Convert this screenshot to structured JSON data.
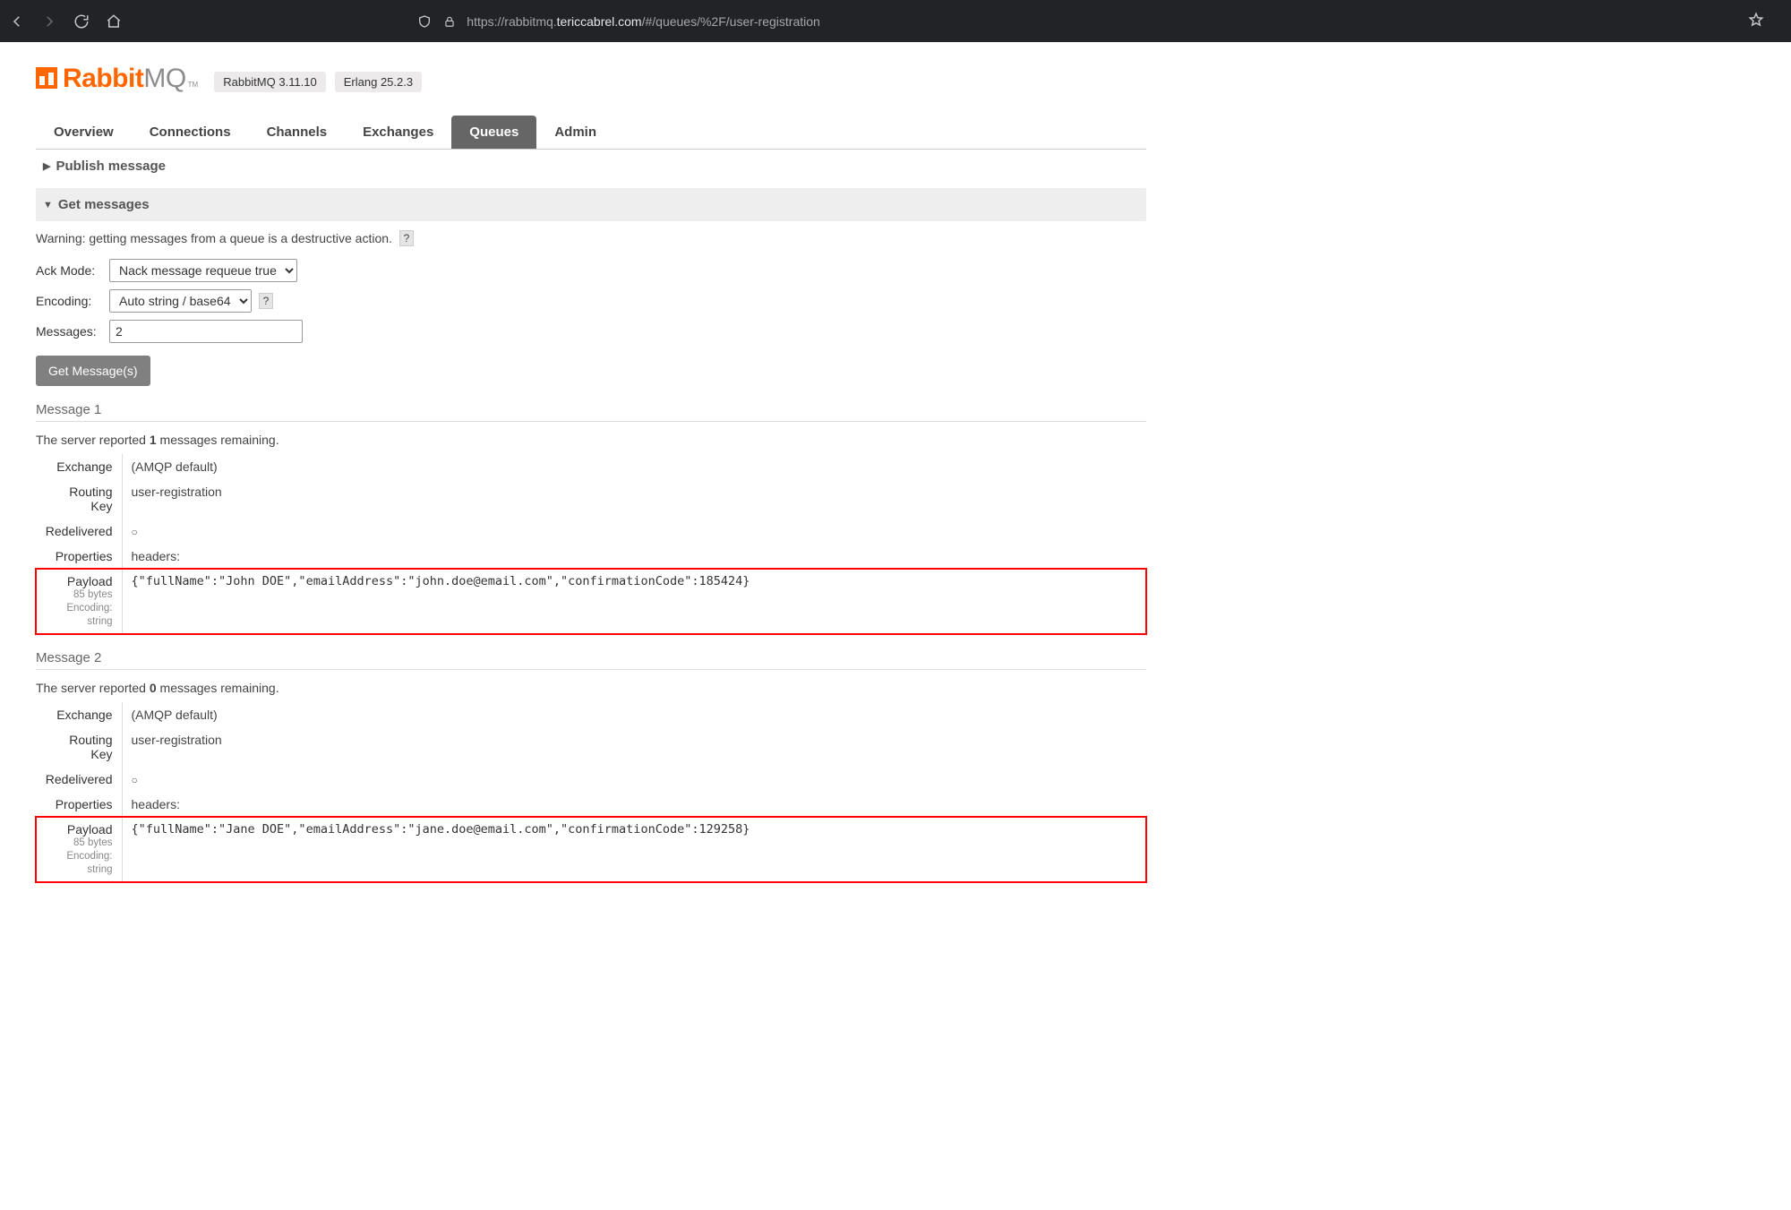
{
  "browser": {
    "url_host": "tericcabrel.com",
    "url_prefix": "https://rabbitmq.",
    "url_path": "/#/queues/%2F/user-registration"
  },
  "logo": {
    "left": "Rabbit",
    "right": "MQ",
    "tm": "TM"
  },
  "versions": {
    "rabbit": "RabbitMQ 3.11.10",
    "erlang": "Erlang 25.2.3"
  },
  "nav": {
    "overview": "Overview",
    "connections": "Connections",
    "channels": "Channels",
    "exchanges": "Exchanges",
    "queues": "Queues",
    "admin": "Admin"
  },
  "sections": {
    "publish": "Publish message",
    "get": "Get messages"
  },
  "warning": "Warning: getting messages from a queue is a destructive action.",
  "help_label": "?",
  "form": {
    "ack_label": "Ack Mode:",
    "ack_value": "Nack message requeue true",
    "enc_label": "Encoding:",
    "enc_value": "Auto string / base64",
    "msgs_label": "Messages:",
    "msgs_value": "2",
    "button": "Get Message(s)"
  },
  "labels": {
    "exchange": "Exchange",
    "routing_key": "Routing Key",
    "redelivered": "Redelivered",
    "properties": "Properties",
    "payload": "Payload",
    "headers": "headers:",
    "encoding_prefix": "Encoding: "
  },
  "messages": [
    {
      "title": "Message 1",
      "remaining_before": "The server reported ",
      "remaining_count": "1",
      "remaining_after": " messages remaining.",
      "exchange": "(AMQP default)",
      "routing_key": "user-registration",
      "payload": "{\"fullName\":\"John DOE\",\"emailAddress\":\"john.doe@email.com\",\"confirmationCode\":185424}",
      "payload_bytes": "85 bytes",
      "payload_encoding": "string"
    },
    {
      "title": "Message 2",
      "remaining_before": "The server reported ",
      "remaining_count": "0",
      "remaining_after": " messages remaining.",
      "exchange": "(AMQP default)",
      "routing_key": "user-registration",
      "payload": "{\"fullName\":\"Jane DOE\",\"emailAddress\":\"jane.doe@email.com\",\"confirmationCode\":129258}",
      "payload_bytes": "85 bytes",
      "payload_encoding": "string"
    }
  ]
}
